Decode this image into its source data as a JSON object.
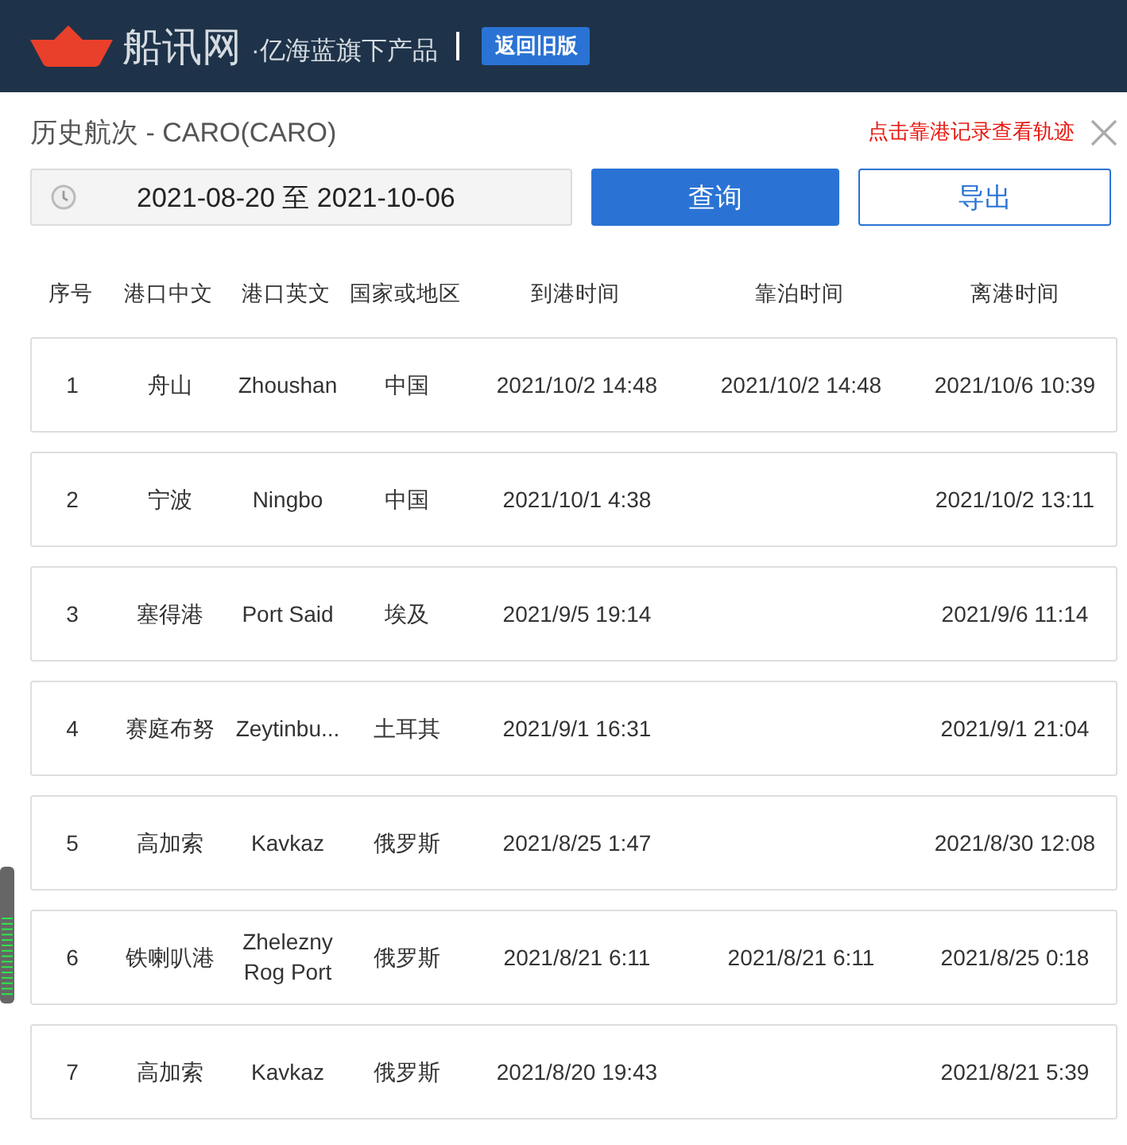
{
  "header": {
    "brand": "船讯网",
    "tagline": "·亿海蓝旗下产品",
    "old_version_button": "返回旧版"
  },
  "panel": {
    "title": "历史航次 - CARO(CARO)",
    "hint": "点击靠港记录查看轨迹",
    "date_range": "2021-08-20 至 2021-10-06",
    "query_button": "查询",
    "export_button": "导出"
  },
  "table": {
    "columns": [
      "序号",
      "港口中文",
      "港口英文",
      "国家或地区",
      "到港时间",
      "靠泊时间",
      "离港时间"
    ],
    "rows": [
      [
        "1",
        "舟山",
        "Zhoushan",
        "中国",
        "2021/10/2 14:48",
        "2021/10/2 14:48",
        "2021/10/6 10:39"
      ],
      [
        "2",
        "宁波",
        "Ningbo",
        "中国",
        "2021/10/1 4:38",
        "",
        "2021/10/2 13:11"
      ],
      [
        "3",
        "塞得港",
        "Port Said",
        "埃及",
        "2021/9/5 19:14",
        "",
        "2021/9/6 11:14"
      ],
      [
        "4",
        "赛庭布努",
        "Zeytinbu...",
        "土耳其",
        "2021/9/1 16:31",
        "",
        "2021/9/1 21:04"
      ],
      [
        "5",
        "高加索",
        "Kavkaz",
        "俄罗斯",
        "2021/8/25 1:47",
        "",
        "2021/8/30 12:08"
      ],
      [
        "6",
        "铁喇叭港",
        "Zhelezny Rog Port",
        "俄罗斯",
        "2021/8/21 6:11",
        "2021/8/21 6:11",
        "2021/8/25 0:18"
      ],
      [
        "7",
        "高加索",
        "Kavkaz",
        "俄罗斯",
        "2021/8/20 19:43",
        "",
        "2021/8/21 5:39"
      ]
    ]
  }
}
